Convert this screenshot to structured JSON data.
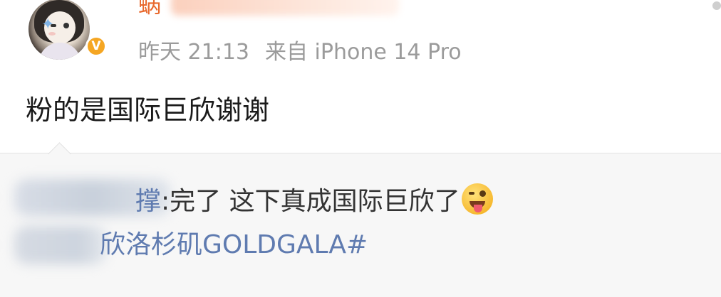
{
  "post": {
    "username": "蜗",
    "timestamp": "昨天 21:13",
    "source": "来自 iPhone 14 Pro",
    "text": "粉的是国际巨欣谢谢",
    "verified_badge": "V"
  },
  "quote": {
    "username_tail": "撑",
    "text": ":完了 这下真成国际巨欣了",
    "emoji": "😜",
    "hashtag": "欣洛杉矶GOLDGALA#"
  },
  "colors": {
    "username": "#e8682c",
    "meta": "#9b9b9b",
    "link": "#5f7bb0",
    "quote_bg": "#f7f7f7",
    "badge": "#f5a623"
  },
  "icons": {
    "avatar": "avatar-image",
    "verified": "verified-v-badge-icon",
    "emoji": "winking-tongue-emoji-icon"
  }
}
